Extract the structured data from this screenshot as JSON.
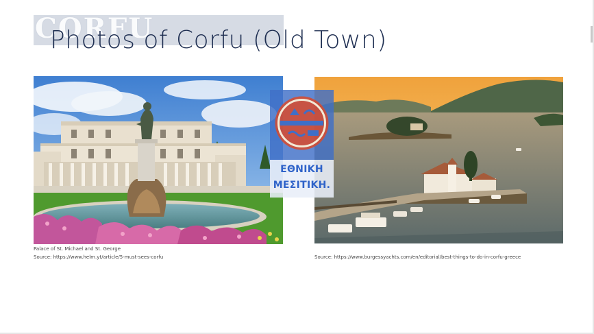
{
  "slide": {
    "logo_word": "CORFU",
    "title": "Photos of Corfu (Old Town)"
  },
  "photos": [
    {
      "id": "palace",
      "caption": "Palace of St. Michael and St. George",
      "source": "Source: https://www.helm.yt/article/5-must-sees-corfu"
    },
    {
      "id": "islet",
      "source": "Source: https://www.burgessyachts.com/en/editorial/best-things-to-do-in-corfu-greece"
    }
  ],
  "watermark": {
    "line1": "ΕΘΝΙΚΗ",
    "line2": "ΜΕΣΙΤΙΚΗ."
  },
  "colors": {
    "title": "#1f2f52",
    "logo_band": "#d6dbe4",
    "watermark_blue": "#3f6fc7",
    "watermark_text": "#2f63c9",
    "emblem_red": "#d94a2b"
  }
}
